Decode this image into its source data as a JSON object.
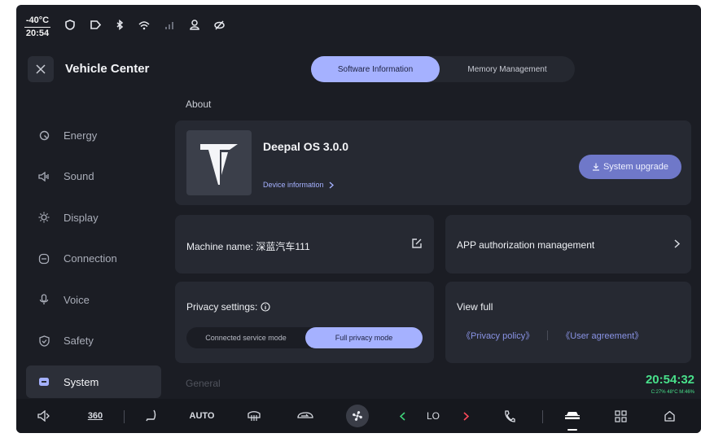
{
  "status": {
    "temperature": "-40°C",
    "time": "20:54"
  },
  "header": {
    "title": "Vehicle Center",
    "tabs": [
      {
        "label": "Software Information",
        "active": true
      },
      {
        "label": "Memory Management",
        "active": false
      }
    ]
  },
  "sidebar": {
    "items": [
      {
        "label": "Energy",
        "icon": "energy-icon"
      },
      {
        "label": "Sound",
        "icon": "speaker-icon"
      },
      {
        "label": "Display",
        "icon": "brightness-icon"
      },
      {
        "label": "Connection",
        "icon": "connection-icon"
      },
      {
        "label": "Voice",
        "icon": "microphone-icon"
      },
      {
        "label": "Safety",
        "icon": "shield-icon"
      },
      {
        "label": "System",
        "icon": "system-icon",
        "active": true
      }
    ]
  },
  "main": {
    "section_about": "About",
    "os_name": "Deepal OS 3.0.0",
    "device_info": "Device information",
    "upgrade_label": "System upgrade",
    "machine_name": "Machine name: 深蓝汽车111",
    "app_auth": "APP authorization management",
    "privacy_label": "Privacy settings:",
    "modes": [
      {
        "label": "Connected service mode",
        "active": false
      },
      {
        "label": "Full privacy mode",
        "active": true
      }
    ],
    "view_full": "View full",
    "privacy_policy": "《Privacy policy》",
    "user_agreement": "《User agreement》",
    "section_general": "General"
  },
  "overlay": {
    "time": "20:54:32",
    "meta": "C:27% 48°C M:46%"
  },
  "dock": {
    "auto": "AUTO",
    "mode_360": "360",
    "temp": "LO"
  },
  "colors": {
    "accent": "#a5b1ff",
    "background": "#1b1d24",
    "card": "#262932",
    "overlay_green": "#48e08a"
  }
}
